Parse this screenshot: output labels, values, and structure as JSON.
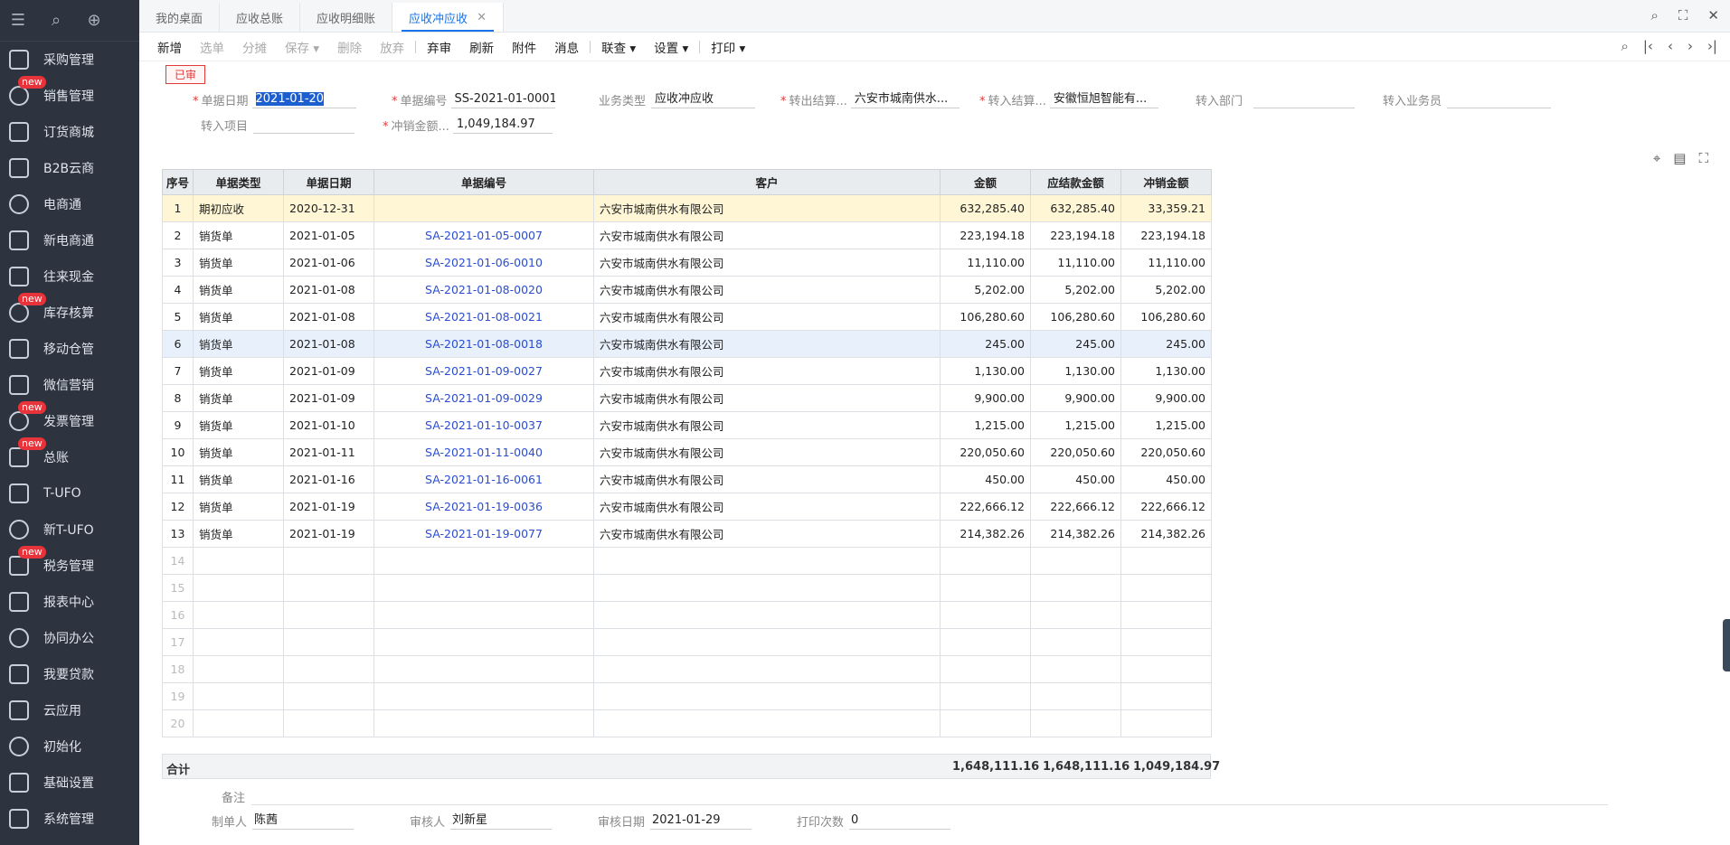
{
  "sidebar": {
    "top_icons": [
      "menu-icon",
      "search-doc-icon",
      "add-doc-icon"
    ],
    "items": [
      {
        "label": "采购管理",
        "icon": "cart-icon",
        "new": false
      },
      {
        "label": "销售管理",
        "icon": "chart-icon",
        "new": true
      },
      {
        "label": "订货商城",
        "icon": "store-icon",
        "new": false
      },
      {
        "label": "B2B云商",
        "icon": "bag-icon",
        "new": false
      },
      {
        "label": "电商通",
        "icon": "ecommerce-icon",
        "new": false
      },
      {
        "label": "新电商通",
        "icon": "new-ecommerce-icon",
        "new": false
      },
      {
        "label": "往来现金",
        "icon": "exchange-icon",
        "new": false
      },
      {
        "label": "库存核算",
        "icon": "inventory-icon",
        "new": true
      },
      {
        "label": "移动仓管",
        "icon": "mobile-warehouse-icon",
        "new": false
      },
      {
        "label": "微信营销",
        "icon": "wechat-icon",
        "new": false
      },
      {
        "label": "发票管理",
        "icon": "invoice-icon",
        "new": true
      },
      {
        "label": "总账",
        "icon": "ledger-icon",
        "new": true
      },
      {
        "label": "T-UFO",
        "icon": "tufo-icon",
        "new": false
      },
      {
        "label": "新T-UFO",
        "icon": "new-tufo-icon",
        "new": false
      },
      {
        "label": "税务管理",
        "icon": "tax-icon",
        "new": true
      },
      {
        "label": "报表中心",
        "icon": "report-icon",
        "new": false
      },
      {
        "label": "协同办公",
        "icon": "collab-icon",
        "new": false
      },
      {
        "label": "我要贷款",
        "icon": "loan-icon",
        "new": false
      },
      {
        "label": "云应用",
        "icon": "cloud-icon",
        "new": false
      },
      {
        "label": "初始化",
        "icon": "init-icon",
        "new": false
      },
      {
        "label": "基础设置",
        "icon": "settings-icon",
        "new": false
      },
      {
        "label": "系统管理",
        "icon": "system-icon",
        "new": false
      }
    ],
    "new_badge": "new"
  },
  "tabs": [
    {
      "label": "我的桌面",
      "active": false
    },
    {
      "label": "应收总账",
      "active": false
    },
    {
      "label": "应收明细账",
      "active": false
    },
    {
      "label": "应收冲应收",
      "active": true
    }
  ],
  "toolbar": {
    "buttons": [
      {
        "label": "新增",
        "disabled": false
      },
      {
        "label": "选单",
        "disabled": true
      },
      {
        "label": "分摊",
        "disabled": true
      },
      {
        "label": "保存",
        "disabled": true,
        "dropdown": true
      },
      {
        "label": "删除",
        "disabled": true
      },
      {
        "label": "放弃",
        "disabled": true
      },
      {
        "label": "弃审",
        "disabled": false
      },
      {
        "label": "刷新",
        "disabled": false
      },
      {
        "label": "附件",
        "disabled": false
      },
      {
        "label": "消息",
        "disabled": false
      },
      {
        "label": "联查",
        "disabled": false,
        "dropdown": true
      },
      {
        "label": "设置",
        "disabled": false,
        "dropdown": true
      },
      {
        "label": "打印",
        "disabled": false,
        "dropdown": true
      }
    ]
  },
  "form": {
    "status": "已审",
    "date_label": "单据日期",
    "date_value": "2021-01-20",
    "number_label": "单据编号",
    "number_value": "SS-2021-01-0001",
    "biz_type_label": "业务类型",
    "biz_type_value": "应收冲应收",
    "out_label": "转出结算...",
    "out_value": "六安市城南供水...",
    "in_label": "转入结算...",
    "in_value": "安徽恒旭智能有...",
    "in_dept_label": "转入部门",
    "in_dept_value": "",
    "in_staff_label": "转入业务员",
    "in_staff_value": "",
    "in_project_label": "转入项目",
    "in_project_value": "",
    "amount_label": "冲销金额...",
    "amount_value": "1,049,184.97"
  },
  "table": {
    "headers": [
      "序号",
      "单据类型",
      "单据日期",
      "单据编号",
      "客户",
      "金额",
      "应结款金额",
      "冲销金额"
    ],
    "rows": [
      {
        "idx": "1",
        "type": "期初应收",
        "date": "2020-12-31",
        "no": "",
        "customer": "六安市城南供水有限公司",
        "amount": "632,285.40",
        "due": "632,285.40",
        "offset": "33,359.21"
      },
      {
        "idx": "2",
        "type": "销货单",
        "date": "2021-01-05",
        "no": "SA-2021-01-05-0007",
        "customer": "六安市城南供水有限公司",
        "amount": "223,194.18",
        "due": "223,194.18",
        "offset": "223,194.18"
      },
      {
        "idx": "3",
        "type": "销货单",
        "date": "2021-01-06",
        "no": "SA-2021-01-06-0010",
        "customer": "六安市城南供水有限公司",
        "amount": "11,110.00",
        "due": "11,110.00",
        "offset": "11,110.00"
      },
      {
        "idx": "4",
        "type": "销货单",
        "date": "2021-01-08",
        "no": "SA-2021-01-08-0020",
        "customer": "六安市城南供水有限公司",
        "amount": "5,202.00",
        "due": "5,202.00",
        "offset": "5,202.00"
      },
      {
        "idx": "5",
        "type": "销货单",
        "date": "2021-01-08",
        "no": "SA-2021-01-08-0021",
        "customer": "六安市城南供水有限公司",
        "amount": "106,280.60",
        "due": "106,280.60",
        "offset": "106,280.60"
      },
      {
        "idx": "6",
        "type": "销货单",
        "date": "2021-01-08",
        "no": "SA-2021-01-08-0018",
        "customer": "六安市城南供水有限公司",
        "amount": "245.00",
        "due": "245.00",
        "offset": "245.00"
      },
      {
        "idx": "7",
        "type": "销货单",
        "date": "2021-01-09",
        "no": "SA-2021-01-09-0027",
        "customer": "六安市城南供水有限公司",
        "amount": "1,130.00",
        "due": "1,130.00",
        "offset": "1,130.00"
      },
      {
        "idx": "8",
        "type": "销货单",
        "date": "2021-01-09",
        "no": "SA-2021-01-09-0029",
        "customer": "六安市城南供水有限公司",
        "amount": "9,900.00",
        "due": "9,900.00",
        "offset": "9,900.00"
      },
      {
        "idx": "9",
        "type": "销货单",
        "date": "2021-01-10",
        "no": "SA-2021-01-10-0037",
        "customer": "六安市城南供水有限公司",
        "amount": "1,215.00",
        "due": "1,215.00",
        "offset": "1,215.00"
      },
      {
        "idx": "10",
        "type": "销货单",
        "date": "2021-01-11",
        "no": "SA-2021-01-11-0040",
        "customer": "六安市城南供水有限公司",
        "amount": "220,050.60",
        "due": "220,050.60",
        "offset": "220,050.60"
      },
      {
        "idx": "11",
        "type": "销货单",
        "date": "2021-01-16",
        "no": "SA-2021-01-16-0061",
        "customer": "六安市城南供水有限公司",
        "amount": "450.00",
        "due": "450.00",
        "offset": "450.00"
      },
      {
        "idx": "12",
        "type": "销货单",
        "date": "2021-01-19",
        "no": "SA-2021-01-19-0036",
        "customer": "六安市城南供水有限公司",
        "amount": "222,666.12",
        "due": "222,666.12",
        "offset": "222,666.12"
      },
      {
        "idx": "13",
        "type": "销货单",
        "date": "2021-01-19",
        "no": "SA-2021-01-19-0077",
        "customer": "六安市城南供水有限公司",
        "amount": "214,382.26",
        "due": "214,382.26",
        "offset": "214,382.26"
      }
    ],
    "empty_rows": [
      "14",
      "15",
      "16",
      "17",
      "18",
      "19",
      "20"
    ],
    "highlight_row": 1,
    "selected_row": 6
  },
  "totals": {
    "label": "合计",
    "amount": "1,648,111.16",
    "due": "1,648,111.16",
    "offset": "1,049,184.97"
  },
  "footer": {
    "memo_label": "备注",
    "maker_label": "制单人",
    "maker_value": "陈茜",
    "auditor_label": "审核人",
    "auditor_value": "刘新星",
    "audit_date_label": "审核日期",
    "audit_date_value": "2021-01-29",
    "print_count_label": "打印次数",
    "print_count_value": "0"
  },
  "colors": {
    "accent": "#1a73e8",
    "sidebar": "#2d3440",
    "required": "#e13a3a",
    "link": "#2a4dd1",
    "highlight": "#fff6d6"
  }
}
